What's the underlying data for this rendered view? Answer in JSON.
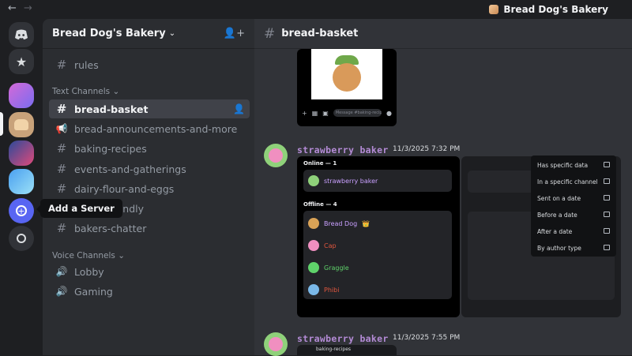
{
  "titlebar": {
    "back": "←",
    "forward": "→",
    "server_name": "Bread Dog's Bakery"
  },
  "sidebar": {
    "server_name": "Bread Dog's Bakery",
    "tooltip": "Add a Server",
    "categories": {
      "text": "Text Channels",
      "voice": "Voice Channels"
    },
    "channels": [
      {
        "label": "rules",
        "icon": "#"
      },
      {
        "label": "bread-basket",
        "icon": "#"
      },
      {
        "label": "bread-announcements-and-more",
        "icon": "📢"
      },
      {
        "label": "baking-recipes",
        "icon": "#"
      },
      {
        "label": "events-and-gatherings",
        "icon": "#"
      },
      {
        "label": "dairy-flour-and-eggs",
        "icon": "#"
      },
      {
        "label": "bread-friendly",
        "icon": "#"
      },
      {
        "label": "bakers-chatter",
        "icon": "#"
      }
    ],
    "voice": [
      {
        "label": "Lobby"
      },
      {
        "label": "Gaming"
      }
    ]
  },
  "main": {
    "channel": "bread-basket",
    "messages": [
      {
        "author": "strawberry baker",
        "time": "11/3/2025 7:32 PM"
      },
      {
        "author": "strawberry baker",
        "time": "11/3/2025 7:55 PM"
      }
    ],
    "embed": {
      "online_label": "Online — 1",
      "offline_label": "Offline — 4",
      "online": [
        {
          "name": "strawberry baker",
          "color": "#c9a0ff"
        }
      ],
      "offline": [
        {
          "name": "Bread Dog",
          "color": "#c9a0ff"
        },
        {
          "name": "Cap",
          "color": "#e0563e"
        },
        {
          "name": "Graggle",
          "color": "#5fd26a"
        },
        {
          "name": "Phibi",
          "color": "#e0563e"
        }
      ],
      "crown": "👑",
      "phone_input": "Message #baking-recipes"
    },
    "filter_menu": [
      "Has specific data",
      "In a specific channel",
      "Sent on a date",
      "Before a date",
      "After a date",
      "By author type"
    ],
    "embed2_title": "baking-recipes"
  }
}
